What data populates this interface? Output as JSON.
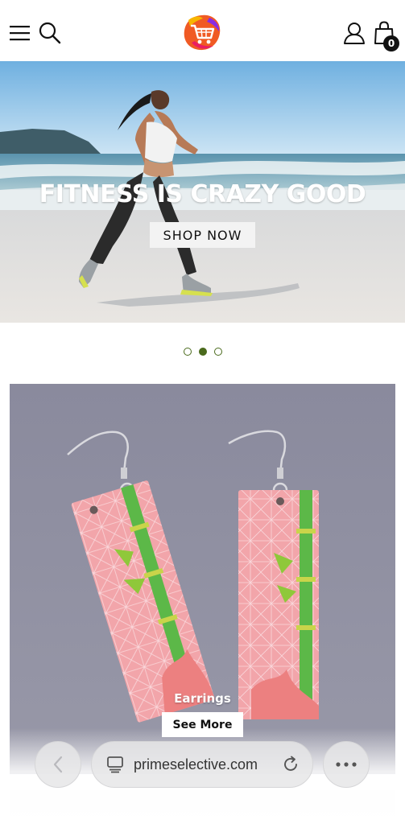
{
  "header": {
    "menu_icon": "hamburger-menu-icon",
    "search_icon": "search-icon",
    "logo_icon": "shopping-cart-logo",
    "account_icon": "user-icon",
    "cart_icon": "shopping-bag-icon",
    "cart_count": "0"
  },
  "hero": {
    "title": "FITNESS IS CRAZY GOOD",
    "button_label": "SHOP NOW"
  },
  "carousel": {
    "slides": 3,
    "active_index": 1,
    "accent": "#4a6a1c"
  },
  "product": {
    "label": "Earrings",
    "button_label": "See More",
    "background": "#8a8a9c"
  },
  "browser": {
    "url": "primeselective.com",
    "back_icon": "chevron-left-icon",
    "tabs_icon": "tabs-icon",
    "reload_icon": "reload-icon",
    "more_icon": "more-dots-icon"
  }
}
